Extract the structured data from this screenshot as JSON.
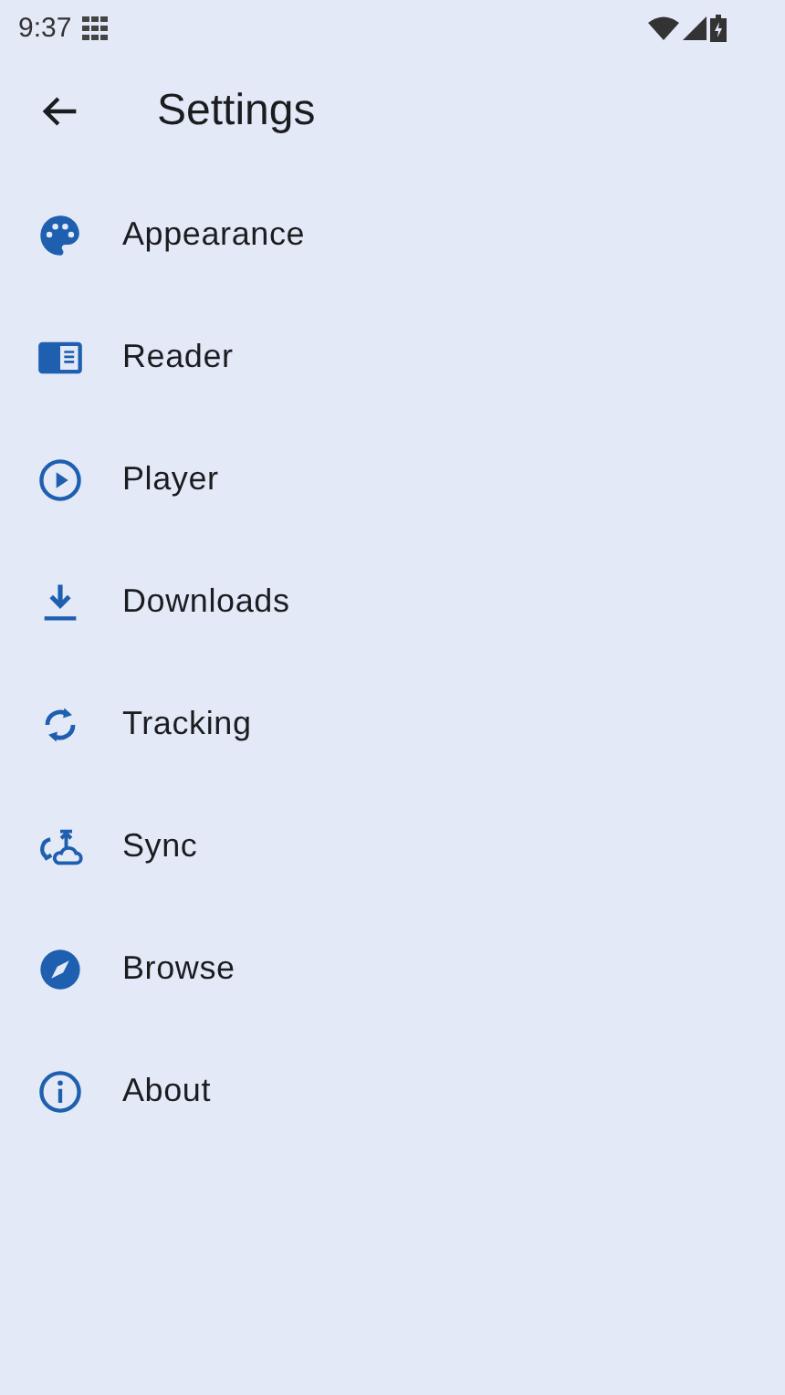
{
  "status_bar": {
    "time": "9:37"
  },
  "app_bar": {
    "title": "Settings"
  },
  "items": [
    {
      "kind": "palette",
      "label": "Appearance"
    },
    {
      "kind": "reader",
      "label": "Reader"
    },
    {
      "kind": "player",
      "label": "Player"
    },
    {
      "kind": "download",
      "label": "Downloads"
    },
    {
      "kind": "sync",
      "label": "Tracking"
    },
    {
      "kind": "cloud",
      "label": "Sync"
    },
    {
      "kind": "compass",
      "label": "Browse"
    },
    {
      "kind": "info",
      "label": "About"
    }
  ]
}
